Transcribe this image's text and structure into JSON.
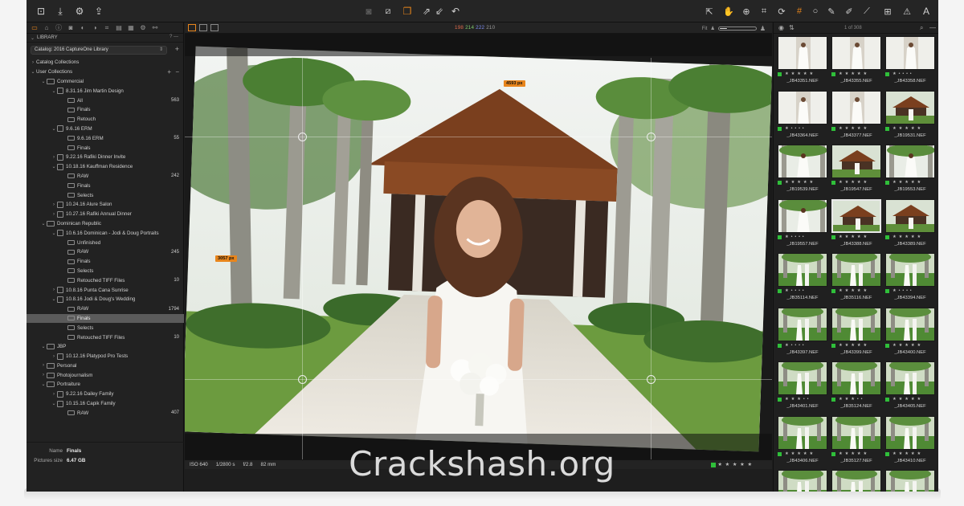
{
  "toolbar": {
    "left_icons": [
      "import-icon",
      "export-icon",
      "gear-icon",
      "upload-icon"
    ],
    "center_icons": [
      "camera-icon",
      "edit-icon",
      "variants-icon",
      "arrow-up-right-icon",
      "arrow-down-left-icon",
      "undo-icon"
    ],
    "right_icons": [
      "cursor-icon",
      "hand-icon",
      "zoom-icon",
      "crop-icon",
      "rotate-icon",
      "keystone-icon",
      "circle-icon",
      "brush-icon",
      "eraser-icon",
      "picker-icon",
      "grid-icon",
      "warning-icon",
      "text-icon"
    ]
  },
  "left_panel": {
    "library_title": "LIBRARY",
    "library_help": "?",
    "catalog_name": "Catalog: 2016 CaptureOne Library",
    "tree": [
      {
        "indent": 0,
        "arrow": "›",
        "icon": "none",
        "label": "Catalog Collections",
        "count": ""
      },
      {
        "indent": 0,
        "arrow": "⌄",
        "icon": "none",
        "label": "User Collections",
        "count": "",
        "actions": true
      },
      {
        "indent": 1,
        "arrow": "⌄",
        "icon": "folder",
        "label": "Commercial",
        "count": ""
      },
      {
        "indent": 2,
        "arrow": "⌄",
        "icon": "project",
        "label": "8.31.16 Jim Martin Design",
        "count": ""
      },
      {
        "indent": 3,
        "arrow": "",
        "icon": "album",
        "label": "All",
        "count": "563"
      },
      {
        "indent": 3,
        "arrow": "",
        "icon": "album",
        "label": "Finals",
        "count": ""
      },
      {
        "indent": 3,
        "arrow": "",
        "icon": "album",
        "label": "Retouch",
        "count": ""
      },
      {
        "indent": 2,
        "arrow": "⌄",
        "icon": "project",
        "label": "9.6.16 ERM",
        "count": ""
      },
      {
        "indent": 3,
        "arrow": "",
        "icon": "album",
        "label": "9.6.16 ERM",
        "count": "55"
      },
      {
        "indent": 3,
        "arrow": "",
        "icon": "album",
        "label": "Finals",
        "count": ""
      },
      {
        "indent": 2,
        "arrow": "›",
        "icon": "project",
        "label": "9.22.16 Rafiki Dinner Invite",
        "count": ""
      },
      {
        "indent": 2,
        "arrow": "⌄",
        "icon": "project",
        "label": "10.18.16 Kauffman Residence",
        "count": ""
      },
      {
        "indent": 3,
        "arrow": "",
        "icon": "album",
        "label": "RAW",
        "count": "242"
      },
      {
        "indent": 3,
        "arrow": "",
        "icon": "album",
        "label": "Finals",
        "count": ""
      },
      {
        "indent": 3,
        "arrow": "",
        "icon": "album",
        "label": "Selects",
        "count": ""
      },
      {
        "indent": 2,
        "arrow": "›",
        "icon": "project",
        "label": "10.24.16 Alure Salon",
        "count": ""
      },
      {
        "indent": 2,
        "arrow": "›",
        "icon": "project",
        "label": "10.27.16 Rafiki Annual Dinner",
        "count": ""
      },
      {
        "indent": 1,
        "arrow": "⌄",
        "icon": "folder",
        "label": "Dominican Republic",
        "count": ""
      },
      {
        "indent": 2,
        "arrow": "⌄",
        "icon": "project",
        "label": "10.6.16 Dominican - Jodi & Doug Portraits",
        "count": ""
      },
      {
        "indent": 3,
        "arrow": "",
        "icon": "album",
        "label": "Unfinished",
        "count": ""
      },
      {
        "indent": 3,
        "arrow": "",
        "icon": "album",
        "label": "RAW",
        "count": "245"
      },
      {
        "indent": 3,
        "arrow": "",
        "icon": "album",
        "label": "Finals",
        "count": ""
      },
      {
        "indent": 3,
        "arrow": "",
        "icon": "album",
        "label": "Selects",
        "count": ""
      },
      {
        "indent": 3,
        "arrow": "",
        "icon": "album",
        "label": "Retouched TIFF Files",
        "count": "10"
      },
      {
        "indent": 2,
        "arrow": "›",
        "icon": "project",
        "label": "10.8.16 Punta Cana Sunrise",
        "count": ""
      },
      {
        "indent": 2,
        "arrow": "⌄",
        "icon": "project",
        "label": "10.8.16 Jodi & Doug's Wedding",
        "count": ""
      },
      {
        "indent": 3,
        "arrow": "",
        "icon": "album",
        "label": "RAW",
        "count": "1794"
      },
      {
        "indent": 3,
        "arrow": "",
        "icon": "album",
        "label": "Finals",
        "count": "",
        "selected": true
      },
      {
        "indent": 3,
        "arrow": "",
        "icon": "album",
        "label": "Selects",
        "count": ""
      },
      {
        "indent": 3,
        "arrow": "",
        "icon": "album",
        "label": "Retouched TIFF Files",
        "count": "10"
      },
      {
        "indent": 1,
        "arrow": "⌄",
        "icon": "folder",
        "label": "JBP",
        "count": ""
      },
      {
        "indent": 2,
        "arrow": "›",
        "icon": "project",
        "label": "10.12.16 Platypod Pro Tests",
        "count": ""
      },
      {
        "indent": 1,
        "arrow": "›",
        "icon": "folder",
        "label": "Personal",
        "count": ""
      },
      {
        "indent": 1,
        "arrow": "›",
        "icon": "folder",
        "label": "Photojournalism",
        "count": ""
      },
      {
        "indent": 1,
        "arrow": "⌄",
        "icon": "folder",
        "label": "Portraiture",
        "count": ""
      },
      {
        "indent": 2,
        "arrow": "›",
        "icon": "project",
        "label": "9.22.16 Dailey Family",
        "count": ""
      },
      {
        "indent": 2,
        "arrow": "⌄",
        "icon": "project",
        "label": "10.15.16 Capik Family",
        "count": ""
      },
      {
        "indent": 3,
        "arrow": "",
        "icon": "album",
        "label": "RAW",
        "count": "407"
      }
    ],
    "meta": {
      "name_label": "Name",
      "name_value": "Finals",
      "size_label": "Pictures size",
      "size_value": "6.47 GB"
    }
  },
  "viewer": {
    "rgb": {
      "r": "198",
      "g": "214",
      "b": "222",
      "k": "210"
    },
    "fit_label": "Fit",
    "zoom_level": 0.25,
    "width_label": "4593 px",
    "height_label": "3057 px",
    "footer": {
      "iso": "ISO 640",
      "shutter": "1/2800 s",
      "aperture": "f/2.8",
      "focal": "82 mm",
      "stars": "★ ★ ★ ★ ★"
    }
  },
  "browser": {
    "count_text": "1 of 308",
    "thumbs": [
      {
        "name": "_JB43351.NEF",
        "stars": "★ ★ ★ ★ ★",
        "scene": "gown",
        "selected": false
      },
      {
        "name": "_JB43355.NEF",
        "stars": "★ ★ ★ ★ ★",
        "scene": "gown",
        "selected": false
      },
      {
        "name": "_JB43358.NEF",
        "stars": "★ • • • •",
        "scene": "gown",
        "selected": false
      },
      {
        "name": "_JB43364.NEF",
        "stars": "★ • • • •",
        "scene": "gown",
        "selected": false
      },
      {
        "name": "_JB43377.NEF",
        "stars": "★ ★ ★ ★ ★",
        "scene": "gown",
        "selected": false
      },
      {
        "name": "_JB19531.NEF",
        "stars": "★ ★ ★ ★ ★",
        "scene": "house",
        "selected": false
      },
      {
        "name": "_JB19539.NEF",
        "stars": "★ ★ ★ ★ ★",
        "scene": "bride",
        "selected": false
      },
      {
        "name": "_JB19547.NEF",
        "stars": "★ ★ ★ ★ ★",
        "scene": "house",
        "selected": false
      },
      {
        "name": "_JB19553.NEF",
        "stars": "★ ★ ★ ★ ★",
        "scene": "bride",
        "selected": false
      },
      {
        "name": "_JB19557.NEF",
        "stars": "★ • • • •",
        "scene": "bride",
        "selected": false
      },
      {
        "name": "_JB43388.NEF",
        "stars": "★ ★ ★ ★ ★",
        "scene": "house",
        "selected": true
      },
      {
        "name": "_JB43389.NEF",
        "stars": "★ ★ ★ ★ ★",
        "scene": "house",
        "selected": false
      },
      {
        "name": "_JB35114.NEF",
        "stars": "★ • • • •",
        "scene": "garden",
        "selected": false
      },
      {
        "name": "_JB35116.NEF",
        "stars": "★ ★ ★ ★ ★",
        "scene": "garden",
        "selected": false
      },
      {
        "name": "_JB43394.NEF",
        "stars": "★ • • • •",
        "scene": "garden",
        "selected": false
      },
      {
        "name": "_JB43397.NEF",
        "stars": "★ • • • •",
        "scene": "garden",
        "selected": false
      },
      {
        "name": "_JB43399.NEF",
        "stars": "★ ★ ★ ★ ★",
        "scene": "garden",
        "selected": false
      },
      {
        "name": "_JB43400.NEF",
        "stars": "★ ★ ★ ★ ★",
        "scene": "garden",
        "selected": false
      },
      {
        "name": "_JB43401.NEF",
        "stars": "★ ★ ★ • •",
        "scene": "garden",
        "selected": false
      },
      {
        "name": "_JB35124.NEF",
        "stars": "★ ★ ★ • •",
        "scene": "garden",
        "selected": false
      },
      {
        "name": "_JB43405.NEF",
        "stars": "★ ★ ★ ★ ★",
        "scene": "garden",
        "selected": false
      },
      {
        "name": "_JB43406.NEF",
        "stars": "★ ★ ★ ★ ★",
        "scene": "garden",
        "selected": false
      },
      {
        "name": "_JB35127.NEF",
        "stars": "★ ★ ★ ★ ★",
        "scene": "garden",
        "selected": false
      },
      {
        "name": "_JB43410.NEF",
        "stars": "★ ★ ★ ★ ★",
        "scene": "garden",
        "selected": false
      },
      {
        "name": "",
        "stars": "",
        "scene": "garden",
        "selected": false
      },
      {
        "name": "",
        "stars": "",
        "scene": "garden",
        "selected": false
      },
      {
        "name": "",
        "stars": "",
        "scene": "garden",
        "selected": false
      }
    ]
  },
  "watermark": "Crackshash.org",
  "colors": {
    "accent": "#e8851c",
    "green_tag": "#2fbf3a",
    "panel": "#222222"
  }
}
